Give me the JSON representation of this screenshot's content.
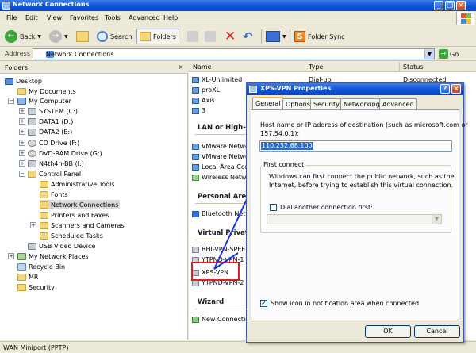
{
  "window": {
    "title": "Network Connections"
  },
  "menu": [
    "File",
    "Edit",
    "View",
    "Favorites",
    "Tools",
    "Advanced",
    "Help"
  ],
  "toolbar": {
    "back": "Back",
    "search": "Search",
    "folders": "Folders",
    "folder_sync": "Folder Sync"
  },
  "address": {
    "label": "Address",
    "value": "Network Connections",
    "go": "Go"
  },
  "folders_pane": {
    "header": "Folders",
    "items": [
      "Desktop",
      "My Documents",
      "My Computer",
      "SYSTEM (C:)",
      "DATA1 (D:)",
      "DATA2 (E:)",
      "CD Drive (F:)",
      "DVD-RAM Drive (G:)",
      "N4th4n-BB (I:)",
      "Control Panel",
      "Administrative Tools",
      "Fonts",
      "Network Connections",
      "Printers and Faxes",
      "Scanners and Cameras",
      "Scheduled Tasks",
      "USB Video Device",
      "My Network Places",
      "Recycle Bin",
      "MR",
      "Security"
    ]
  },
  "list": {
    "columns": [
      "Name",
      "Type",
      "Status"
    ],
    "dialup": [
      {
        "name": "XL-Unlimited",
        "type": "Dial-up",
        "status": "Disconnected"
      },
      {
        "name": "proXL",
        "type": "",
        "status": ""
      },
      {
        "name": "Axis",
        "type": "",
        "status": ""
      },
      {
        "name": "3",
        "type": "",
        "status": ""
      }
    ],
    "groups": {
      "lan": "LAN or High-Sp",
      "pan": "Personal Area",
      "vpn": "Virtual Private",
      "wizard": "Wizard"
    },
    "lan_items": [
      "VMware Netwo",
      "VMware Netwo",
      "Local Area Con",
      "Wireless Netwo"
    ],
    "pan_items": [
      "Bluetooth Netw"
    ],
    "vpn_items": [
      "BHI-VPN-SPEED",
      "YTPND-VPN-1",
      "XPS-VPN",
      "YTPND-VPN-2"
    ],
    "wizard_items": [
      "New Connectio"
    ]
  },
  "status_bar": "WAN Miniport (PPTP)",
  "dialog": {
    "title": "XPS-VPN Properties",
    "tabs": [
      "General",
      "Options",
      "Security",
      "Networking",
      "Advanced"
    ],
    "host_label_1": "Host name or IP address of destination (such as microsoft.com or",
    "host_label_2": "157.54.0.1):",
    "host_value": "110.232.68.100",
    "first_connect": "First connect",
    "first_connect_desc_1": "Windows can first connect the public network, such as the",
    "first_connect_desc_2": "Internet, before trying to establish this virtual connection.",
    "dial_another": "Dial another connection first:",
    "show_icon": "Show icon in notification area when connected",
    "ok": "OK",
    "cancel": "Cancel"
  }
}
